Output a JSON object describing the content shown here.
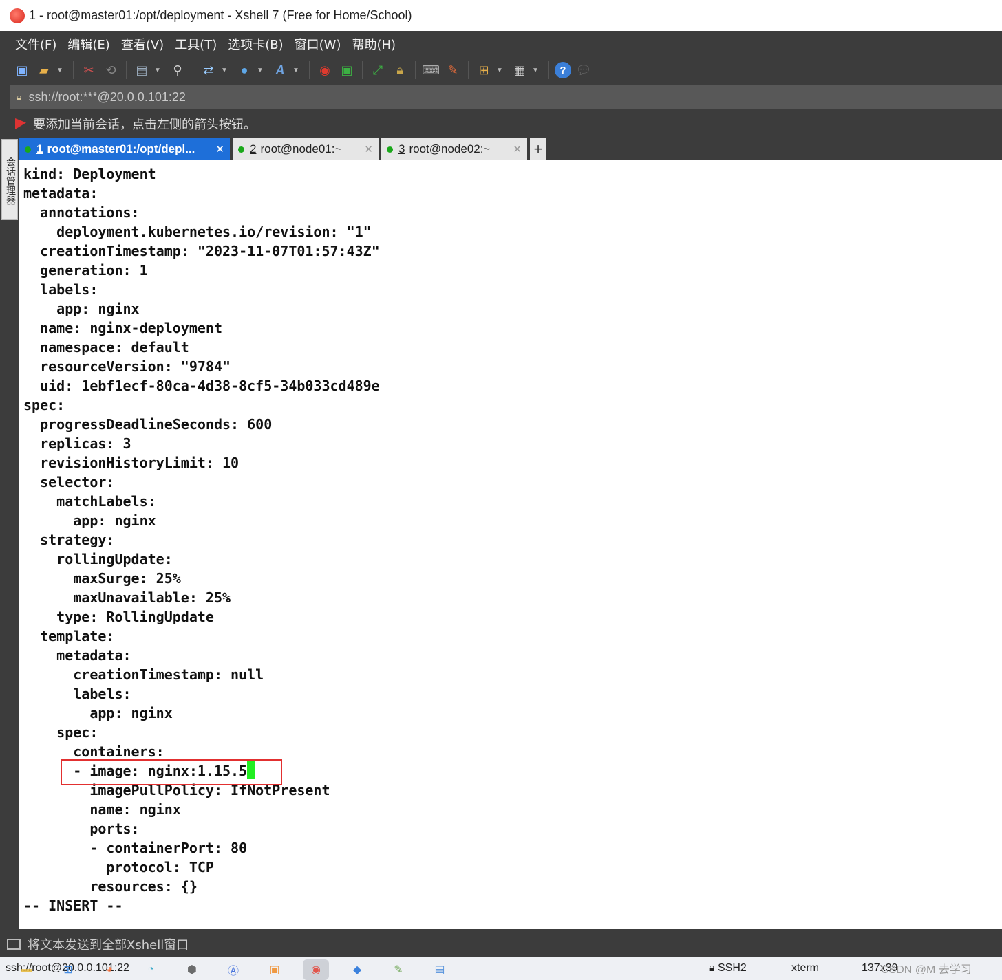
{
  "window": {
    "title": "1 - root@master01:/opt/deployment - Xshell 7 (Free for Home/School)"
  },
  "menu": [
    "文件(F)",
    "编辑(E)",
    "查看(V)",
    "工具(T)",
    "选项卡(B)",
    "窗口(W)",
    "帮助(H)"
  ],
  "address": {
    "value": "ssh://root:***@20.0.0.101:22"
  },
  "hint": {
    "text": "要添加当前会话，点击左侧的箭头按钮。"
  },
  "side_tab": {
    "label": "会话管理器"
  },
  "tabs": [
    {
      "num": "1",
      "label": "root@master01:/opt/depl...",
      "active": true
    },
    {
      "num": "2",
      "label": "root@node01:~",
      "active": false
    },
    {
      "num": "3",
      "label": "root@node02:~",
      "active": false
    }
  ],
  "terminal": {
    "lines": [
      "kind: Deployment",
      "metadata:",
      "  annotations:",
      "    deployment.kubernetes.io/revision: \"1\"",
      "  creationTimestamp: \"2023-11-07T01:57:43Z\"",
      "  generation: 1",
      "  labels:",
      "    app: nginx",
      "  name: nginx-deployment",
      "  namespace: default",
      "  resourceVersion: \"9784\"",
      "  uid: 1ebf1ecf-80ca-4d38-8cf5-34b033cd489e",
      "spec:",
      "  progressDeadlineSeconds: 600",
      "  replicas: 3",
      "  revisionHistoryLimit: 10",
      "  selector:",
      "    matchLabels:",
      "      app: nginx",
      "  strategy:",
      "    rollingUpdate:",
      "      maxSurge: 25%",
      "      maxUnavailable: 25%",
      "    type: RollingUpdate",
      "  template:",
      "    metadata:",
      "      creationTimestamp: null",
      "      labels:",
      "        app: nginx",
      "    spec:",
      "      containers:",
      "      - image: nginx:1.15.5",
      "        imagePullPolicy: IfNotPresent",
      "        name: nginx",
      "        ports:",
      "        - containerPort: 80",
      "          protocol: TCP",
      "        resources: {}",
      "-- INSERT --"
    ],
    "cursor_line": 31
  },
  "sendbar": {
    "label": "将文本发送到全部Xshell窗口"
  },
  "status": {
    "connection": "ssh://root@20.0.0.101:22",
    "protocol": "SSH2",
    "terminal_type": "xterm",
    "size": "137x39",
    "watermark": "CSDN @M  去学习"
  },
  "colors": {
    "tab_active": "#1e6fd9",
    "cursor": "#22ee22",
    "highlight": "#e23030",
    "chrome": "#3c3c3c"
  }
}
